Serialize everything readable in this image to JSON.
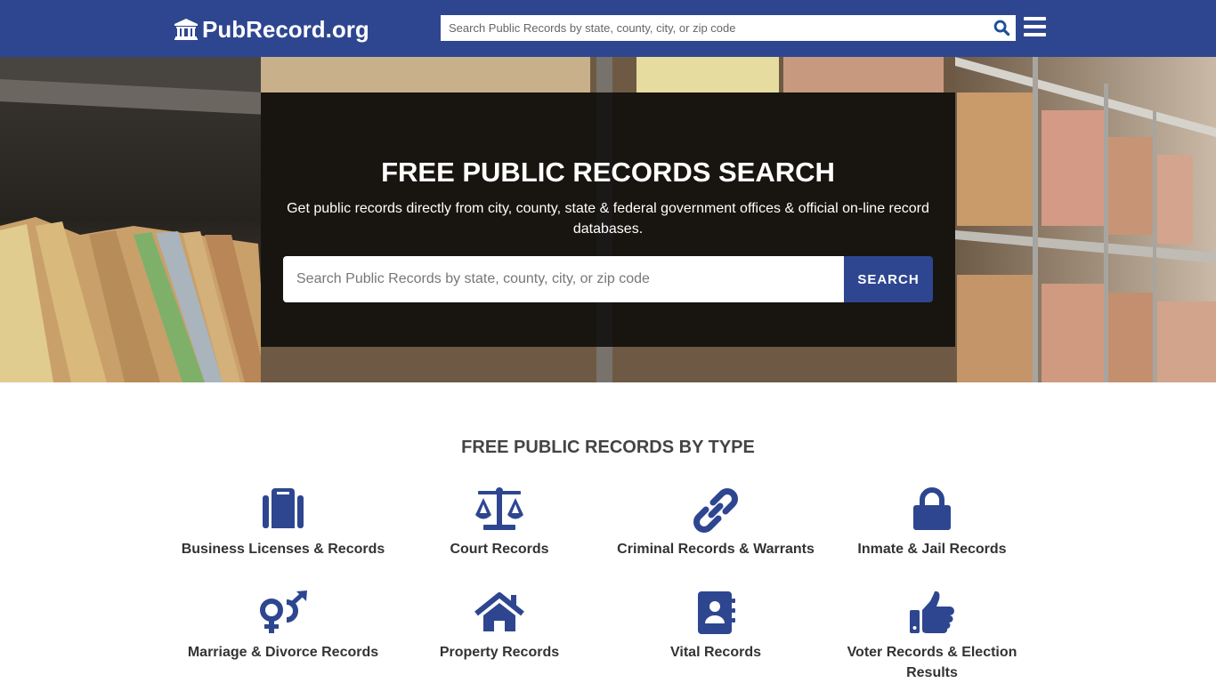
{
  "header": {
    "logo_text": "PubRecord.org",
    "logo_icon": "bank-building-icon",
    "search_placeholder": "Search Public Records by state, county, city, or zip code",
    "search_icon": "search-icon",
    "menu_icon": "hamburger-menu-icon"
  },
  "hero": {
    "title": "FREE PUBLIC RECORDS SEARCH",
    "subtitle": "Get public records directly from city, county, state & federal government offices & official on-line record databases.",
    "search_placeholder": "Search Public Records by state, county, city, or zip code",
    "search_button": "SEARCH"
  },
  "types": {
    "heading": "FREE PUBLIC RECORDS BY TYPE",
    "items": [
      {
        "label": "Business Licenses & Records",
        "icon": "suitcase-icon"
      },
      {
        "label": "Court Records",
        "icon": "balance-scale-icon"
      },
      {
        "label": "Criminal Records & Warrants",
        "icon": "chain-link-icon"
      },
      {
        "label": "Inmate & Jail Records",
        "icon": "lock-icon"
      },
      {
        "label": "Marriage & Divorce Records",
        "icon": "venus-mars-icon"
      },
      {
        "label": "Property Records",
        "icon": "home-icon"
      },
      {
        "label": "Vital Records",
        "icon": "address-book-icon"
      },
      {
        "label": "Voter Records & Election Results",
        "icon": "thumbs-up-icon"
      }
    ]
  },
  "colors": {
    "brand": "#2e4690",
    "text": "#333333",
    "heading": "#444444"
  }
}
